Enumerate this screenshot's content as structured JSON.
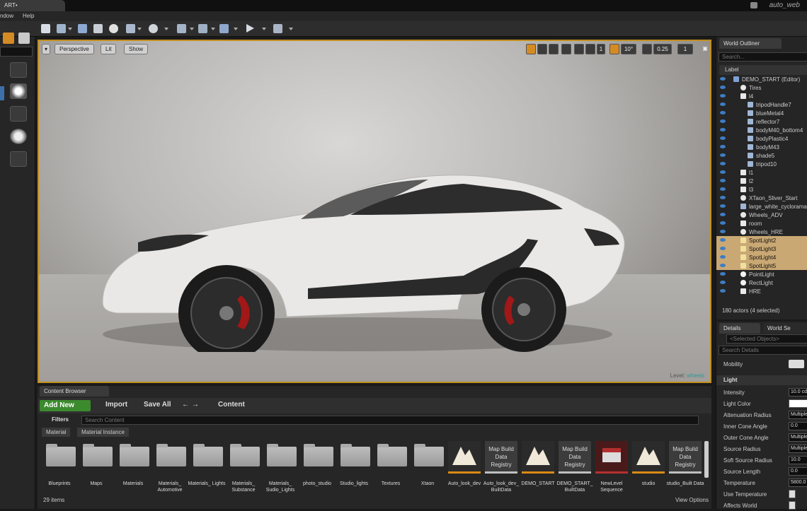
{
  "window": {
    "tab_title": "ART•",
    "project": "auto_web"
  },
  "menu": [
    "ndow",
    "Help"
  ],
  "viewport": {
    "perspective_label": "Perspective",
    "lit_label": "Lit",
    "show_label": "Show",
    "angle_snap": "10°",
    "scale_snap": "0.25",
    "camera_speed": "1",
    "level_prefix": "Level:",
    "level_name": "wheels"
  },
  "outliner": {
    "tab": "World Outliner",
    "search_placeholder": "Search...",
    "column": "Label",
    "rows": [
      {
        "label": "DEMO_START (Editor)",
        "indent": 0,
        "icon": "world",
        "selected": false
      },
      {
        "label": "Tires",
        "indent": 1,
        "icon": "sphere",
        "selected": false
      },
      {
        "label": "l4",
        "indent": 1,
        "icon": "folder",
        "selected": false
      },
      {
        "label": "tripodHandle7",
        "indent": 2,
        "icon": "mesh",
        "selected": false
      },
      {
        "label": "blueMetal4",
        "indent": 2,
        "icon": "mesh",
        "selected": false
      },
      {
        "label": "reflector7",
        "indent": 2,
        "icon": "mesh",
        "selected": false
      },
      {
        "label": "bodyM40_bottom4",
        "indent": 2,
        "icon": "mesh",
        "selected": false
      },
      {
        "label": "bodyPlastic4",
        "indent": 2,
        "icon": "mesh",
        "selected": false
      },
      {
        "label": "bodyM43",
        "indent": 2,
        "icon": "mesh",
        "selected": false
      },
      {
        "label": "shade5",
        "indent": 2,
        "icon": "mesh",
        "selected": false
      },
      {
        "label": "tripod10",
        "indent": 2,
        "icon": "mesh",
        "selected": false
      },
      {
        "label": "l1",
        "indent": 1,
        "icon": "folder",
        "selected": false
      },
      {
        "label": "l2",
        "indent": 1,
        "icon": "folder",
        "selected": false
      },
      {
        "label": "l3",
        "indent": 1,
        "icon": "folder",
        "selected": false
      },
      {
        "label": "XTaon_Sliver_Start",
        "indent": 1,
        "icon": "sphere",
        "selected": false
      },
      {
        "label": "large_white_cyclorama",
        "indent": 1,
        "icon": "mesh",
        "selected": false
      },
      {
        "label": "Wheels_ADV",
        "indent": 1,
        "icon": "sphere",
        "selected": false
      },
      {
        "label": "room",
        "indent": 1,
        "icon": "folder",
        "selected": false
      },
      {
        "label": "Wheels_HRE",
        "indent": 1,
        "icon": "sphere",
        "selected": false
      },
      {
        "label": "SpotLight2",
        "indent": 1,
        "icon": "light",
        "selected": true
      },
      {
        "label": "SpotLight3",
        "indent": 1,
        "icon": "light",
        "selected": true
      },
      {
        "label": "SpotLight4",
        "indent": 1,
        "icon": "light",
        "selected": true
      },
      {
        "label": "SpotLight5",
        "indent": 1,
        "icon": "light",
        "selected": true
      },
      {
        "label": "PointLight",
        "indent": 1,
        "icon": "bulb",
        "selected": false
      },
      {
        "label": "RectLight",
        "indent": 1,
        "icon": "bulb",
        "selected": false
      },
      {
        "label": "HRE",
        "indent": 1,
        "icon": "folder",
        "selected": false
      }
    ],
    "actor_count": "180 actors (4 selected)"
  },
  "details": {
    "tab": "Details",
    "tab2": "World Se",
    "selected_placeholder": "<Selected Objects>",
    "search_placeholder": "Search Details",
    "mobility_label": "Mobility",
    "section": "Light",
    "properties": [
      {
        "label": "Intensity",
        "value": "10.0 cd"
      },
      {
        "label": "Light Color",
        "value": ""
      },
      {
        "label": "Attenuation Radius",
        "value": "Multiple"
      },
      {
        "label": "Inner Cone Angle",
        "value": "0.0"
      },
      {
        "label": "Outer Cone Angle",
        "value": "Multiple"
      },
      {
        "label": "Source Radius",
        "value": "Multiple"
      },
      {
        "label": "Soft Source Radius",
        "value": "10.0"
      },
      {
        "label": "Source Length",
        "value": "0.0"
      },
      {
        "label": "Temperature",
        "value": "5800.0"
      },
      {
        "label": "Use Temperature",
        "value": ""
      },
      {
        "label": "Affects World",
        "value": ""
      }
    ]
  },
  "content_browser": {
    "tab": "Content Browser",
    "add_new": "Add New",
    "import": "Import",
    "save_all": "Save All",
    "path": "Content",
    "filters": "Filters",
    "search_placeholder": "Search Content",
    "chips": [
      "Material",
      "Material Instance"
    ],
    "assets": [
      {
        "label": "Blueprints",
        "kind": "folder"
      },
      {
        "label": "Maps",
        "kind": "folder"
      },
      {
        "label": "Materials",
        "kind": "folder"
      },
      {
        "label": "Materials_ Automotive",
        "kind": "folder"
      },
      {
        "label": "Materials_ Lights",
        "kind": "folder"
      },
      {
        "label": "Materials_ Substance",
        "kind": "folder"
      },
      {
        "label": "Materials_ Sudio_Lights",
        "kind": "folder"
      },
      {
        "label": "photo_studio",
        "kind": "folder"
      },
      {
        "label": "Studio_lights",
        "kind": "folder"
      },
      {
        "label": "Textures",
        "kind": "folder"
      },
      {
        "label": "Xtaon",
        "kind": "folder"
      },
      {
        "label": "Auto_look_dev",
        "kind": "map"
      },
      {
        "label": "Auto_look_dev_ BuiltData",
        "kind": "registry"
      },
      {
        "label": "DEMO_START",
        "kind": "map"
      },
      {
        "label": "DEMO_START_ BuiltData",
        "kind": "registry"
      },
      {
        "label": "NewLevel Sequence",
        "kind": "sequence"
      },
      {
        "label": "studio",
        "kind": "map"
      },
      {
        "label": "studio_Built Data",
        "kind": "registry"
      }
    ],
    "registry_label": "Map Build Data Registry",
    "item_count": "29 items",
    "view_options": "View Options"
  }
}
